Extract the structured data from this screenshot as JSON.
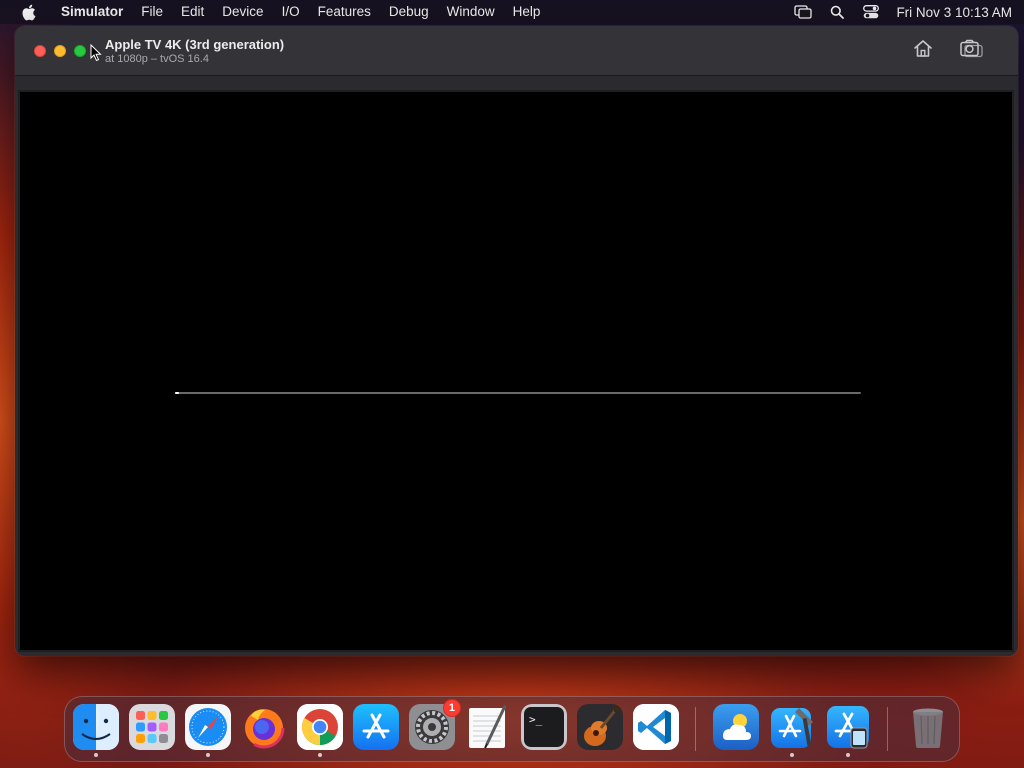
{
  "menubar": {
    "app_name": "Simulator",
    "menus": [
      "File",
      "Edit",
      "Device",
      "I/O",
      "Features",
      "Debug",
      "Window",
      "Help"
    ],
    "clock": "Fri Nov 3  10:13 AM",
    "status_icons": [
      "screen-mirroring-icon",
      "spotlight-search-icon",
      "control-center-icon"
    ]
  },
  "window": {
    "title": "Apple TV 4K (3rd generation)",
    "subtitle": "at 1080p – tvOS 16.4",
    "toolbar_buttons": [
      "home-icon",
      "screenshot-icon"
    ]
  },
  "screen": {
    "background": "#000000",
    "boot_progress": 0.005
  },
  "dock": {
    "apps": [
      {
        "name": "Finder",
        "icon": "finder-icon",
        "running": true
      },
      {
        "name": "Launchpad",
        "icon": "launchpad-icon",
        "running": false
      },
      {
        "name": "Safari",
        "icon": "safari-icon",
        "running": true
      },
      {
        "name": "Firefox",
        "icon": "firefox-icon",
        "running": false
      },
      {
        "name": "Google Chrome",
        "icon": "chrome-icon",
        "running": true
      },
      {
        "name": "App Store",
        "icon": "app-store-icon",
        "running": false
      },
      {
        "name": "System Settings",
        "icon": "system-settings-icon",
        "running": false,
        "badge": "1"
      },
      {
        "name": "TextEdit",
        "icon": "textedit-icon",
        "running": false
      },
      {
        "name": "Terminal",
        "icon": "terminal-icon",
        "running": false
      },
      {
        "name": "GarageBand",
        "icon": "garageband-icon",
        "running": false
      },
      {
        "name": "Visual Studio Code",
        "icon": "vscode-icon",
        "running": false
      },
      {
        "name": "Weather",
        "icon": "weather-icon",
        "running": false
      },
      {
        "name": "Xcode",
        "icon": "xcode-icon",
        "running": true
      },
      {
        "name": "Simulator",
        "icon": "simulator-icon",
        "running": true
      },
      {
        "name": "Trash",
        "icon": "trash-icon",
        "running": false
      }
    ]
  },
  "colors": {
    "close": "#fe5f57",
    "minimize": "#febc2e",
    "zoom": "#28c840",
    "badge": "#ff3b30"
  }
}
